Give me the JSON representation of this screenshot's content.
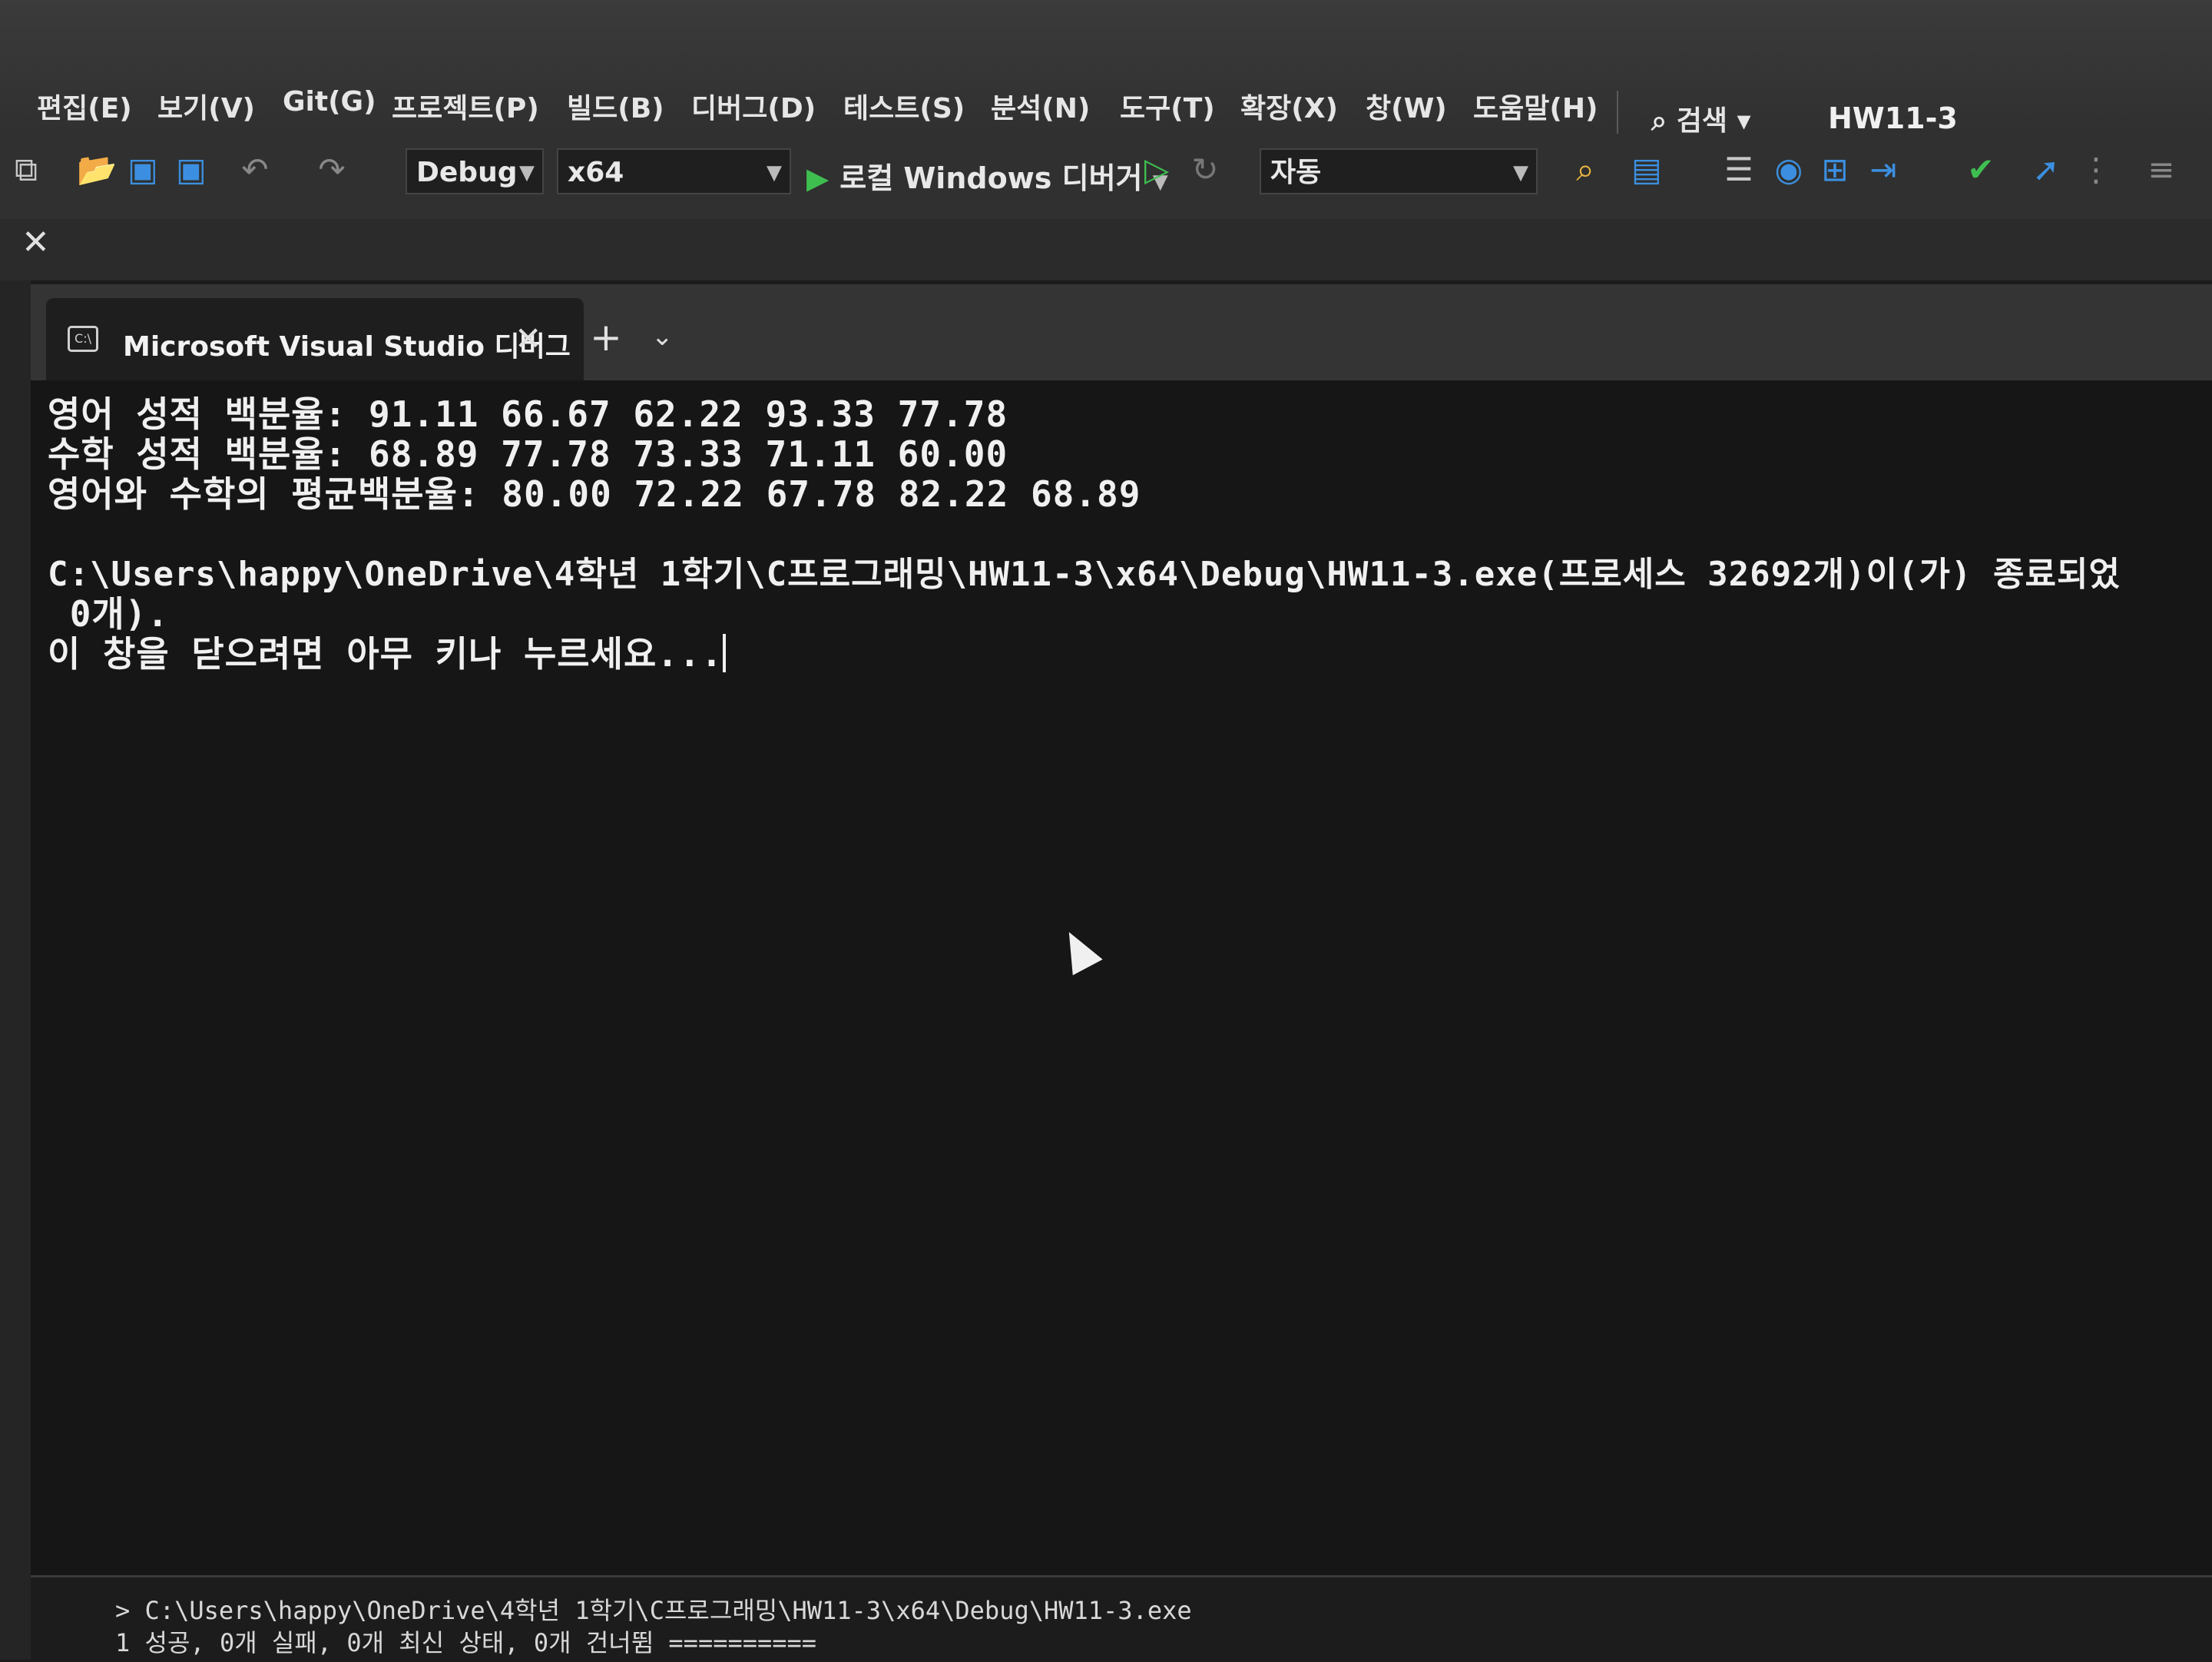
{
  "menu": {
    "items": [
      "편집(E)",
      "보기(V)",
      "Git(G)",
      "프로젝트(P)",
      "빌드(B)",
      "디버그(D)",
      "테스트(S)",
      "분석(N)",
      "도구(T)",
      "확장(X)",
      "창(W)",
      "도움말(H)"
    ],
    "search_label": "검색",
    "solution_name": "HW11-3"
  },
  "toolbar": {
    "configuration": "Debug",
    "platform": "x64",
    "run_target": "로컬 Windows 디버거",
    "mode": "자동"
  },
  "terminal": {
    "tab_title": "Microsoft Visual Studio 디버그",
    "lines": [
      "영어 성적 백분율: 91.11 66.67 62.22 93.33 77.78",
      "수학 성적 백분율: 68.89 77.78 73.33 71.11 60.00",
      "영어와 수학의 평균백분율: 80.00 72.22 67.78 82.22 68.89",
      "",
      "C:\\Users\\happy\\OneDrive\\4학년 1학기\\C프로그래밍\\HW11-3\\x64\\Debug\\HW11-3.exe(프로세스 32692개)이(가) 종료되었",
      " 0개).",
      "이 창을 닫으려면 아무 키나 누르세요..."
    ]
  },
  "output": {
    "lines": [
      "> C:\\Users\\happy\\OneDrive\\4학년 1학기\\C프로그래밍\\HW11-3\\x64\\Debug\\HW11-3.exe",
      "1 성공, 0개 실패, 0개 최신 상태, 0개 건너뜀 =========="
    ]
  }
}
